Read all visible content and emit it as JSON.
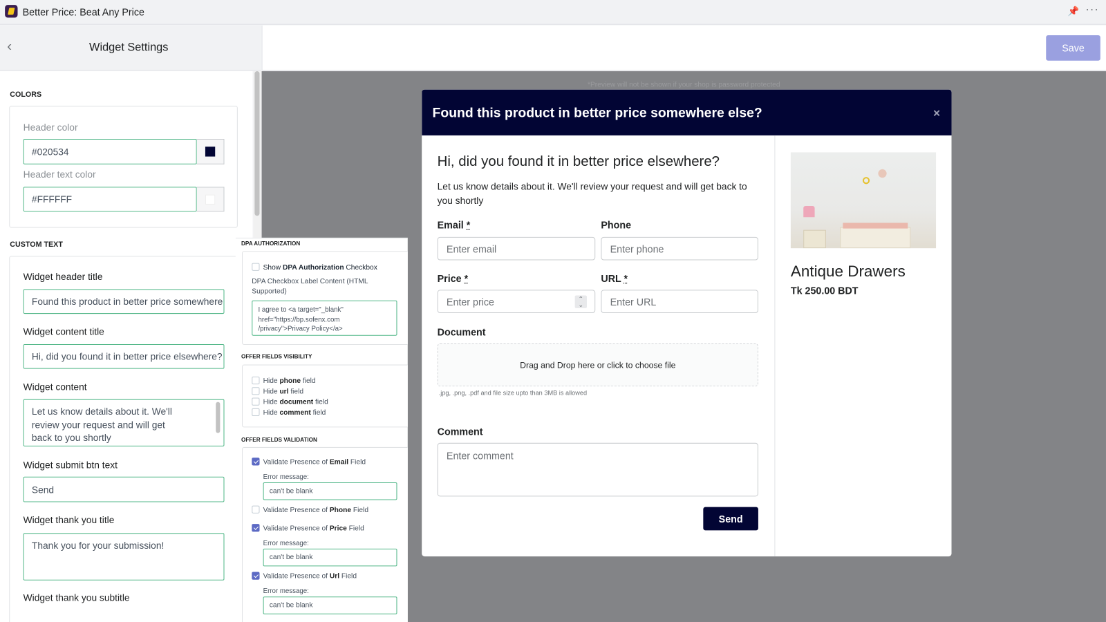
{
  "app": {
    "title": "Better Price: Beat Any Price",
    "pin_icon": "pin-icon",
    "more_icon": "more-icon"
  },
  "sidebar": {
    "title": "Widget Settings",
    "colors": {
      "section": "COLORS",
      "header_color_label": "Header color",
      "header_color_value": "#020534",
      "header_text_color_label": "Header text color",
      "header_text_color_value": "#FFFFFF"
    },
    "custom_text": {
      "section": "CUSTOM TEXT",
      "header_title_label": "Widget header title",
      "header_title_value": "Found this product in better price somewhere else?",
      "content_title_label": "Widget content title",
      "content_title_value": "Hi, did you found it in better price elsewhere?",
      "content_label": "Widget content",
      "content_value": "Let us know details about it. We'll review your request and will get back to you shortly",
      "submit_label": "Widget submit btn text",
      "submit_value": "Send",
      "thank_title_label": "Widget thank you title",
      "thank_title_value": "Thank you for your submission!",
      "thank_subtitle_label": "Widget thank you subtitle"
    }
  },
  "toolbar": {
    "save_label": "Save"
  },
  "dpa": {
    "section": "DPA AUTHORIZATION",
    "show_pre": "Show ",
    "show_bold": "DPA Authorization",
    "show_post": " Checkbox",
    "show_checked": false,
    "content_label": "DPA Checkbox Label Content (HTML Supported)",
    "content_value": "I agree to <a target=\"_blank\" href=\"https://bp.sofenx.com /privacy\">Privacy Policy</a>"
  },
  "visibility": {
    "section": "OFFER FIELDS VISIBILITY",
    "items": [
      {
        "pre": "Hide ",
        "bold": "phone",
        "post": " field",
        "checked": false
      },
      {
        "pre": "Hide ",
        "bold": "url",
        "post": " field",
        "checked": false
      },
      {
        "pre": "Hide ",
        "bold": "document",
        "post": " field",
        "checked": false
      },
      {
        "pre": "Hide ",
        "bold": "comment",
        "post": " field",
        "checked": false
      }
    ]
  },
  "validation": {
    "section": "OFFER FIELDS VALIDATION",
    "error_label": "Error message:",
    "items": [
      {
        "pre": "Validate Presence of ",
        "bold": "Email",
        "post": " Field",
        "checked": true,
        "error": "can't be blank"
      },
      {
        "pre": "Validate Presence of ",
        "bold": "Phone",
        "post": " Field",
        "checked": false
      },
      {
        "pre": "Validate Presence of ",
        "bold": "Price",
        "post": " Field",
        "checked": true,
        "error": "can't be blank"
      },
      {
        "pre": "Validate Presence of ",
        "bold": "Url",
        "post": " Field",
        "checked": true,
        "error": "can't be blank"
      }
    ]
  },
  "preview": {
    "note": "*Preview will not be shown if your shop is password protected",
    "header": "Found this product in better price somewhere else?",
    "close": "×",
    "content_title": "Hi, did you found it in better price elsewhere?",
    "content": "Let us know details about it. We'll review your request and will get back to you shortly",
    "fields": {
      "email_label": "Email",
      "email_placeholder": "Enter email",
      "phone_label": "Phone",
      "phone_placeholder": "Enter phone",
      "price_label": "Price",
      "price_placeholder": "Enter price",
      "url_label": "URL",
      "url_placeholder": "Enter URL",
      "document_label": "Document",
      "dropzone": "Drag and Drop here or click to choose file",
      "file_hint": ".jpg, .png, .pdf and file size upto than 3MB is allowed",
      "comment_label": "Comment",
      "comment_placeholder": "Enter comment",
      "required_mark": "*"
    },
    "send": "Send",
    "product": {
      "name": "Antique Drawers",
      "price": "Tk 250.00 BDT"
    }
  },
  "colors": {
    "header": "#020534",
    "accent": "#5c6ac4",
    "input_border": "#52b788",
    "save": "#9aa0e0"
  }
}
